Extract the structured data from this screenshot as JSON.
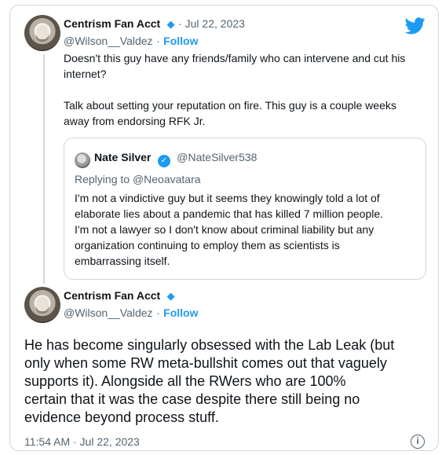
{
  "tweet1": {
    "author": "Centrism Fan Acct",
    "verified_icon": "◆",
    "date": "· Jul 22, 2023",
    "handle": "@Wilson__Valdez",
    "dot": "·",
    "follow": "Follow",
    "text_line1": "Doesn't this guy have any friends/family who can intervene and cut his",
    "text_line2": "internet?",
    "text_line3": "Talk about setting your reputation on fire. This guy is a couple weeks",
    "text_line4": "away from endorsing RFK Jr."
  },
  "quoted": {
    "author": "Nate Silver",
    "verified_icon": "✓",
    "handle": "@NateSilver538",
    "reply_prefix": "Replying to",
    "reply_handle": "@Neoavatara",
    "line1": "I'm not a vindictive guy but it seems they knowingly told a lot of",
    "line2": "elaborate lies about a pandemic that has killed 7 million people.",
    "line3": "I'm not a lawyer so I don't know about criminal liability but any",
    "line4": "organization continuing to employ them as scientists is",
    "line5": "embarrassing itself."
  },
  "tweet2": {
    "author": "Centrism Fan Acct",
    "verified_icon": "◆",
    "handle": "@Wilson__Valdez",
    "dot": "·",
    "follow": "Follow",
    "line1": "He has become singularly obsessed with the Lab Leak (but",
    "line2": "only when some RW meta-bullshit comes out that vaguely",
    "line3": "supports it).  Alongside all the RWers who are 100%",
    "line4": "certain that it was the case despite there still being no",
    "line5": "evidence beyond process stuff.",
    "timestamp": "11:54 AM · Jul 22, 2023",
    "info_icon": "i"
  },
  "colors": {
    "accent": "#1d9bf0",
    "muted": "#536471",
    "border": "#cfd9de"
  }
}
